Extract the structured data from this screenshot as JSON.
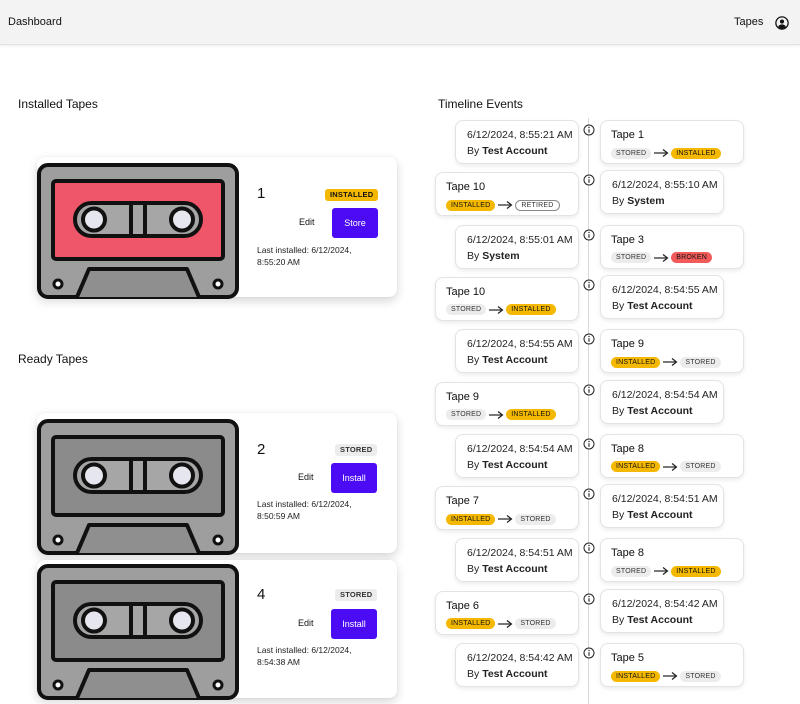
{
  "header": {
    "brand": "Dashboard",
    "nav_tapes": "Tapes",
    "account_icon": "account-circle-icon"
  },
  "installed_section": {
    "title": "Installed Tapes"
  },
  "ready_section": {
    "title": "Ready Tapes"
  },
  "timeline_section": {
    "title": "Timeline Events"
  },
  "tapes": [
    {
      "number": "1",
      "status": "INSTALLED",
      "edit_label": "Edit",
      "action_label": "Store",
      "last_installed": "Last installed: 6/12/2024, 8:55:20 AM",
      "art_color": "#f0566a"
    },
    {
      "number": "2",
      "status": "STORED",
      "edit_label": "Edit",
      "action_label": "Install",
      "last_installed": "Last installed: 6/12/2024, 8:50:59 AM",
      "art_color": "#8b8b8b"
    },
    {
      "number": "4",
      "status": "STORED",
      "edit_label": "Edit",
      "action_label": "Install",
      "last_installed": "Last installed: 6/12/2024, 8:54:38 AM",
      "art_color": "#8b8b8b"
    }
  ],
  "timeline": [
    {
      "time": {
        "date": "6/12/2024, 8:55:21 AM",
        "by_prefix": "By",
        "by": "Test Account"
      },
      "event": {
        "title": "Tape 1",
        "from": "STORED",
        "to": "INSTALLED"
      },
      "event_side": "right"
    },
    {
      "time": {
        "date": "6/12/2024, 8:55:10 AM",
        "by_prefix": "By",
        "by": "System"
      },
      "event": {
        "title": "Tape 10",
        "from": "INSTALLED",
        "to": "RETIRED"
      },
      "event_side": "left"
    },
    {
      "time": {
        "date": "6/12/2024, 8:55:01 AM",
        "by_prefix": "By",
        "by": "System"
      },
      "event": {
        "title": "Tape 3",
        "from": "STORED",
        "to": "BROKEN"
      },
      "event_side": "right"
    },
    {
      "time": {
        "date": "6/12/2024, 8:54:55 AM",
        "by_prefix": "By",
        "by": "Test Account"
      },
      "event": {
        "title": "Tape 10",
        "from": "STORED",
        "to": "INSTALLED"
      },
      "event_side": "left"
    },
    {
      "time": {
        "date": "6/12/2024, 8:54:55 AM",
        "by_prefix": "By",
        "by": "Test Account"
      },
      "event": {
        "title": "Tape 9",
        "from": "INSTALLED",
        "to": "STORED"
      },
      "event_side": "right"
    },
    {
      "time": {
        "date": "6/12/2024, 8:54:54 AM",
        "by_prefix": "By",
        "by": "Test Account"
      },
      "event": {
        "title": "Tape 9",
        "from": "STORED",
        "to": "INSTALLED"
      },
      "event_side": "left"
    },
    {
      "time": {
        "date": "6/12/2024, 8:54:54 AM",
        "by_prefix": "By",
        "by": "Test Account"
      },
      "event": {
        "title": "Tape 8",
        "from": "INSTALLED",
        "to": "STORED"
      },
      "event_side": "right"
    },
    {
      "time": {
        "date": "6/12/2024, 8:54:51 AM",
        "by_prefix": "By",
        "by": "Test Account"
      },
      "event": {
        "title": "Tape 7",
        "from": "INSTALLED",
        "to": "STORED"
      },
      "event_side": "left"
    },
    {
      "time": {
        "date": "6/12/2024, 8:54:51 AM",
        "by_prefix": "By",
        "by": "Test Account"
      },
      "event": {
        "title": "Tape 8",
        "from": "STORED",
        "to": "INSTALLED"
      },
      "event_side": "right"
    },
    {
      "time": {
        "date": "6/12/2024, 8:54:42 AM",
        "by_prefix": "By",
        "by": "Test Account"
      },
      "event": {
        "title": "Tape 6",
        "from": "INSTALLED",
        "to": "STORED"
      },
      "event_side": "left"
    },
    {
      "time": {
        "date": "6/12/2024, 8:54:42 AM",
        "by_prefix": "By",
        "by": "Test Account"
      },
      "event": {
        "title": "Tape 5",
        "from": "INSTALLED",
        "to": "STORED"
      },
      "event_side": "right"
    }
  ]
}
